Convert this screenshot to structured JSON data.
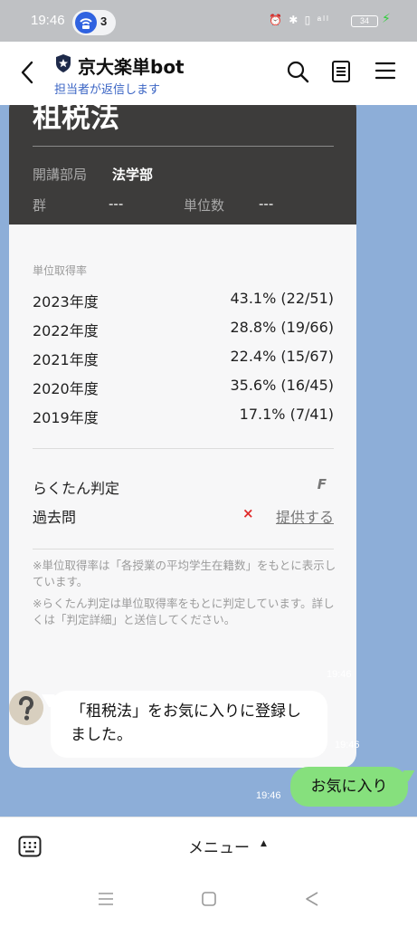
{
  "status_bar": {
    "time": "19:46",
    "hotspot_count": "3",
    "icons": "⏰ ✱ ▯ ᵃˡˡ",
    "battery": "34"
  },
  "header": {
    "title": "京大楽単bot",
    "subtitle": "担当者が返信します"
  },
  "card": {
    "subject": "租税法",
    "dept_label": "開講部局",
    "dept_value": "法学部",
    "group_label": "群",
    "group_value": "---",
    "credits_label": "単位数",
    "credits_value": "---",
    "rates_heading": "単位取得率",
    "rates": [
      {
        "year": "2023年度",
        "rate": "43.1% (22/51)"
      },
      {
        "year": "2022年度",
        "rate": "28.8% (19/66)"
      },
      {
        "year": "2021年度",
        "rate": "22.4% (15/67)"
      },
      {
        "year": "2020年度",
        "rate": "35.6% (16/45)"
      },
      {
        "year": "2019年度",
        "rate": "17.1% (7/41)"
      }
    ],
    "rakutan_label": "らくたん判定",
    "rakutan_value": "F",
    "past_exam_label": "過去問",
    "past_exam_mark": "×",
    "past_exam_link": "提供する",
    "note1": "※単位取得率は「各授業の平均学生在籍数」をもとに表示しています。",
    "note2": "※らくたん判定は単位取得率をもとに判定しています。詳しくは「判定詳細」と送信してください。",
    "timestamp": "19:46"
  },
  "messages": [
    {
      "text": "「租税法」をお気に入りに登録しました。",
      "time": "19:46"
    },
    {
      "text": "お気に入り",
      "time": "19:46"
    }
  ],
  "bottom": {
    "menu_label": "メニュー",
    "caret": "▲"
  }
}
